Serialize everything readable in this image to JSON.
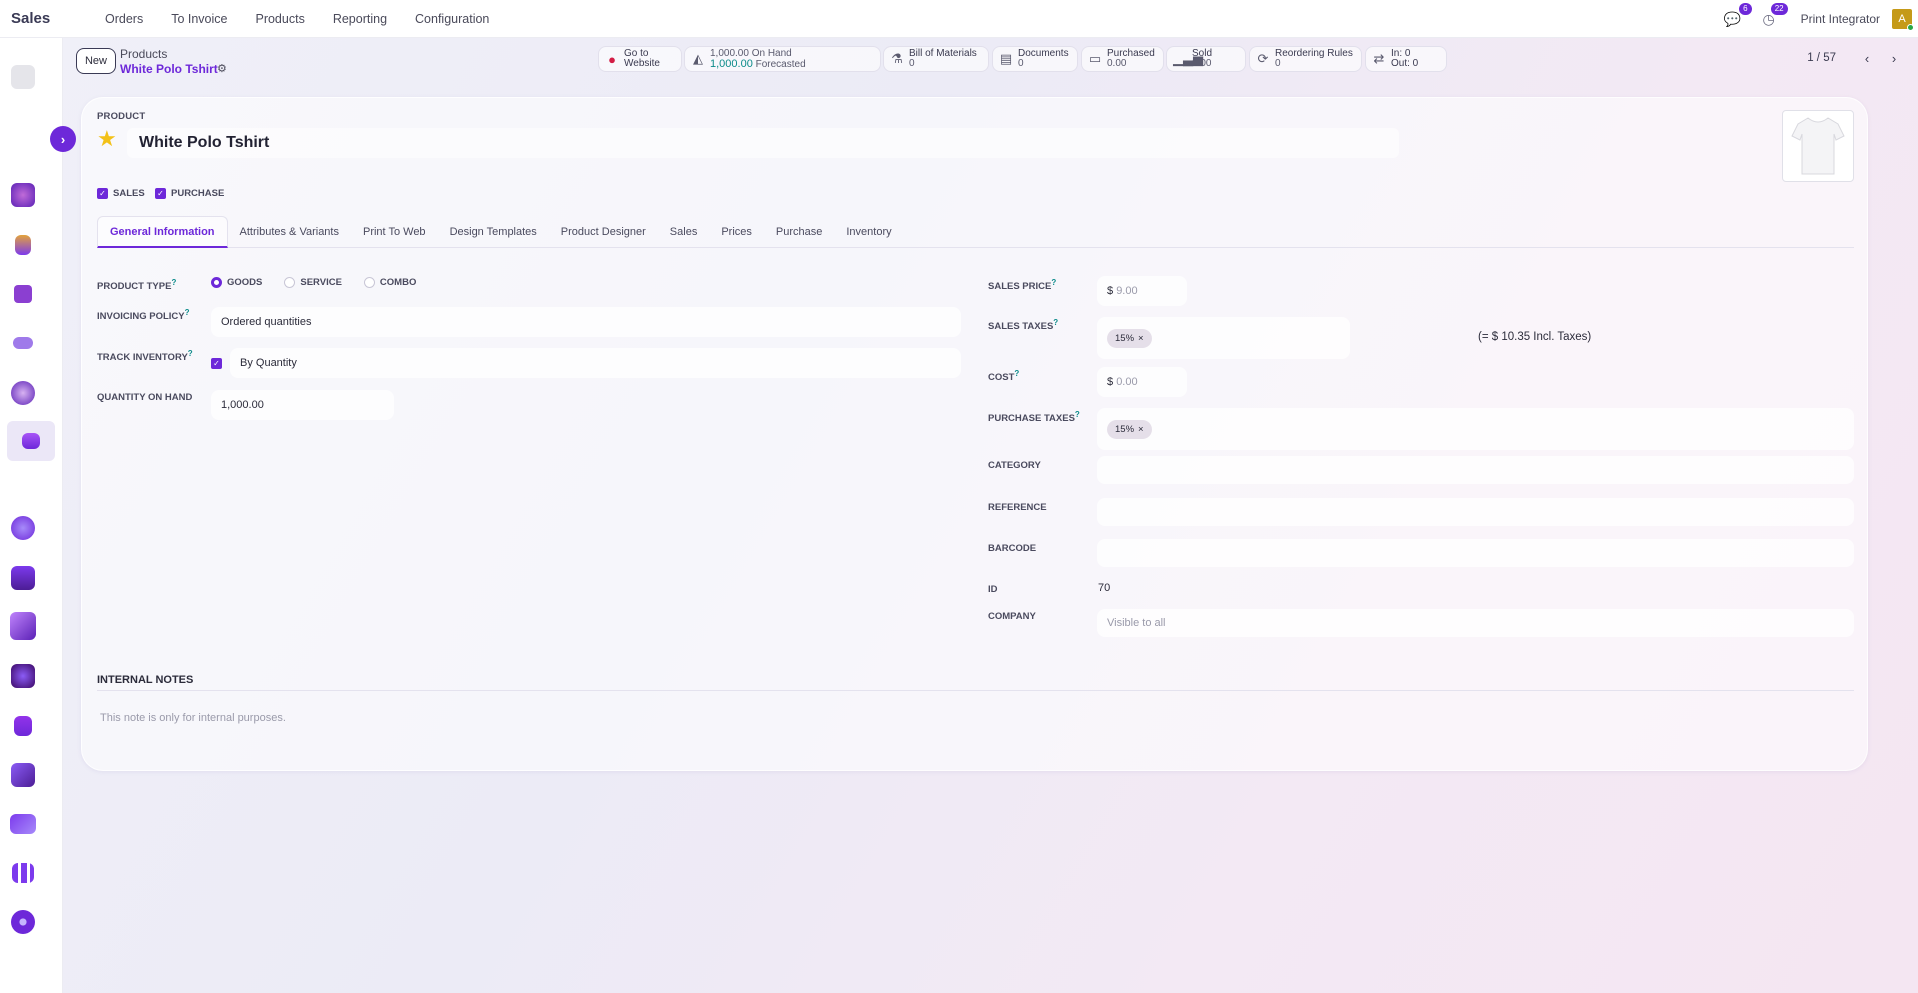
{
  "app": {
    "name": "Sales"
  },
  "menu": [
    {
      "label": "Orders"
    },
    {
      "label": "To Invoice"
    },
    {
      "label": "Products"
    },
    {
      "label": "Reporting"
    },
    {
      "label": "Configuration"
    }
  ],
  "topbar": {
    "messages_count": "6",
    "activities_count": "22",
    "company": "Print Integrator",
    "avatar_letter": "A"
  },
  "control": {
    "new_label": "New",
    "breadcrumb_parent": "Products",
    "breadcrumb_current": "White Polo Tshirt",
    "pager": "1 / 57"
  },
  "smart_buttons": {
    "website": {
      "line1": "Go to",
      "line2": "Website"
    },
    "onhand": {
      "line1": "1,000.00 On Hand",
      "value2": "1,000.00",
      "line2": "Forecasted"
    },
    "bom": {
      "line1": "Bill of Materials",
      "line2": "0"
    },
    "documents": {
      "line1": "Documents",
      "line2": "0"
    },
    "purchased": {
      "line1": "Purchased",
      "line2": "0.00"
    },
    "sold": {
      "line1": "Sold",
      "line2": "0.00"
    },
    "reordering": {
      "line1": "Reordering Rules",
      "line2": "0"
    },
    "inout": {
      "line1": "In: 0",
      "line2": "Out: 0"
    }
  },
  "form": {
    "section_label": "PRODUCT",
    "name": "White Polo Tshirt",
    "sales_cb": "SALES",
    "purchase_cb": "PURCHASE",
    "tabs": [
      {
        "label": "General Information"
      },
      {
        "label": "Attributes & Variants"
      },
      {
        "label": "Print To Web"
      },
      {
        "label": "Design Templates"
      },
      {
        "label": "Product Designer"
      },
      {
        "label": "Sales"
      },
      {
        "label": "Prices"
      },
      {
        "label": "Purchase"
      },
      {
        "label": "Inventory"
      }
    ],
    "left": {
      "product_type_label": "PRODUCT TYPE",
      "type_goods": "GOODS",
      "type_service": "SERVICE",
      "type_combo": "COMBO",
      "invoicing_label": "INVOICING POLICY",
      "invoicing_value": "Ordered quantities",
      "track_label": "TRACK INVENTORY",
      "track_value": "By Quantity",
      "qty_label": "QUANTITY ON HAND",
      "qty_value": "1,000.00"
    },
    "right": {
      "sales_price_label": "SALES PRICE",
      "sales_price_placeholder": "9.00",
      "currency": "$",
      "sales_taxes_label": "SALES TAXES",
      "sales_tax_tag": "15%",
      "incl_taxes": "(= $ 10.35 Incl. Taxes)",
      "cost_label": "COST",
      "cost_placeholder": "0.00",
      "purchase_taxes_label": "PURCHASE TAXES",
      "purchase_tax_tag": "15%",
      "category_label": "CATEGORY",
      "reference_label": "REFERENCE",
      "barcode_label": "BARCODE",
      "id_label": "ID",
      "id_value": "70",
      "company_label": "COMPANY",
      "company_placeholder": "Visible to all"
    },
    "notes_label": "INTERNAL NOTES",
    "notes_placeholder": "This note is only for internal purposes."
  },
  "colors": {
    "accent": "#6d28d9",
    "star": "#f3c118",
    "green": "#0c8b8a"
  }
}
